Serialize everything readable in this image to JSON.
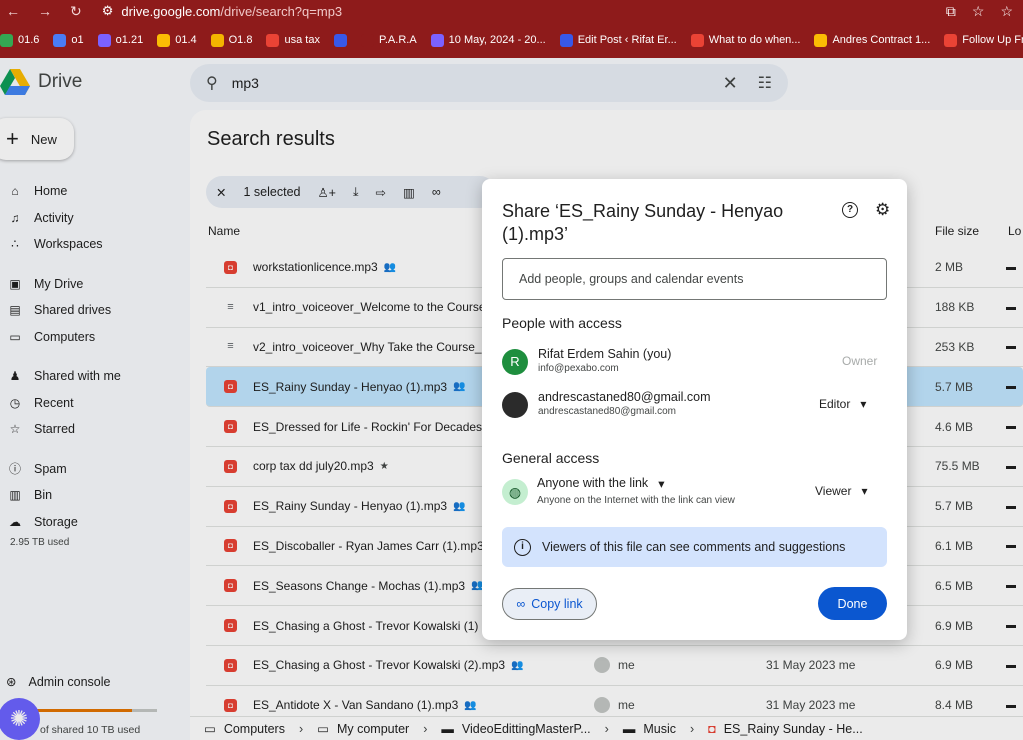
{
  "browser": {
    "url_host": "drive.google.com",
    "url_path": "/drive/search?q=mp3",
    "bookmarks": [
      {
        "label": "01.6",
        "icon": "green-plus-icon",
        "color": "#34a853"
      },
      {
        "label": "o1",
        "icon": "blue-icon",
        "color": "#4a7cf6"
      },
      {
        "label": "o1.21",
        "icon": "purple-icon",
        "color": "#7b61ff"
      },
      {
        "label": "01.4",
        "icon": "drive-icon",
        "color": "#fbbc04"
      },
      {
        "label": "O1.8",
        "icon": "m-icon",
        "color": "#f4b400"
      },
      {
        "label": "usa tax",
        "icon": "gmail-icon",
        "color": "#ea4335"
      },
      {
        "label": "",
        "icon": "wordpress-icon",
        "color": "#3858e9"
      },
      {
        "label": "P.A.R.A",
        "icon": "folder-icon",
        "color": "#8e1b1b"
      },
      {
        "label": "10 May, 2024 - 20...",
        "icon": "gear-icon",
        "color": "#7b61ff"
      },
      {
        "label": "Edit Post ‹ Rifat Er...",
        "icon": "wordpress-icon",
        "color": "#3858e9"
      },
      {
        "label": "What to do when...",
        "icon": "gmail-icon",
        "color": "#ea4335"
      },
      {
        "label": "Andres Contract 1...",
        "icon": "drive-icon",
        "color": "#fbbc04"
      },
      {
        "label": "Follow Up From",
        "icon": "gmail-icon",
        "color": "#ea4335"
      }
    ]
  },
  "app": {
    "logo_text": "Drive",
    "search_query": "mp3",
    "new_label": "New",
    "sidebar": [
      {
        "label": "Home",
        "icon": "home-icon",
        "glyph": "⌂"
      },
      {
        "label": "Activity",
        "icon": "bell-icon",
        "glyph": "♫"
      },
      {
        "label": "Workspaces",
        "icon": "workspaces-icon",
        "glyph": "∴"
      },
      {
        "label": "My Drive",
        "icon": "my-drive-icon",
        "glyph": "▣"
      },
      {
        "label": "Shared drives",
        "icon": "shared-drives-icon",
        "glyph": "▤"
      },
      {
        "label": "Computers",
        "icon": "computers-icon",
        "glyph": "▭"
      },
      {
        "label": "Shared with me",
        "icon": "shared-with-me-icon",
        "glyph": "♟"
      },
      {
        "label": "Recent",
        "icon": "clock-icon",
        "glyph": "◷"
      },
      {
        "label": "Starred",
        "icon": "star-icon",
        "glyph": "☆"
      },
      {
        "label": "Spam",
        "icon": "spam-icon",
        "glyph": "ⓘ"
      },
      {
        "label": "Bin",
        "icon": "bin-icon",
        "glyph": "▥"
      },
      {
        "label": "Storage",
        "icon": "cloud-icon",
        "glyph": "☁"
      }
    ],
    "storage_used": "2.95 TB used",
    "admin_label": "Admin console",
    "shared_used": "of shared 10 TB used",
    "shared_fraction": 0.8
  },
  "main": {
    "title": "Search results",
    "selected_text": "1 selected",
    "columns": {
      "name": "Name",
      "size": "File size",
      "location": "Lo"
    },
    "rows": [
      {
        "name": "workstationlicence.mp3",
        "shared": true,
        "size": "2 MB",
        "type": "audio"
      },
      {
        "name": "v1_intro_voiceover_Welcome to the Course",
        "shared": false,
        "size": "188 KB",
        "type": "doc"
      },
      {
        "name": "v2_intro_voiceover_Why Take the Course_",
        "shared": false,
        "size": "253 KB",
        "type": "doc"
      },
      {
        "name": "ES_Rainy Sunday - Henyao (1).mp3",
        "shared": true,
        "size": "5.7 MB",
        "type": "audio",
        "selected": true
      },
      {
        "name": "ES_Dressed for Life - Rockin' For Decades",
        "shared": false,
        "size": "4.6 MB",
        "type": "audio"
      },
      {
        "name": "corp tax dd july20.mp3",
        "shared": false,
        "starred": true,
        "size": "75.5 MB",
        "type": "audio"
      },
      {
        "name": "ES_Rainy Sunday - Henyao (1).mp3",
        "shared": true,
        "size": "5.7 MB",
        "type": "audio"
      },
      {
        "name": "ES_Discoballer - Ryan James Carr (1).mp3",
        "shared": false,
        "size": "6.1 MB",
        "type": "audio"
      },
      {
        "name": "ES_Seasons Change - Mochas (1).mp3",
        "shared": true,
        "size": "6.5 MB",
        "type": "audio"
      },
      {
        "name": "ES_Chasing a Ghost - Trevor Kowalski (1)",
        "shared": false,
        "size": "6.9 MB",
        "type": "audio"
      },
      {
        "name": "ES_Chasing a Ghost - Trevor Kowalski (2).mp3",
        "shared": true,
        "size": "6.9 MB",
        "type": "audio",
        "owner": "me",
        "modified": "31 May 2023 me"
      },
      {
        "name": "ES_Antidote X - Van Sandano (1).mp3",
        "shared": true,
        "size": "8.4 MB",
        "type": "audio",
        "owner": "me",
        "modified": "31 May 2023 me"
      }
    ],
    "breadcrumb": [
      "Computers",
      "My computer",
      "VideoEdittingMasterP...",
      "Music",
      "ES_Rainy Sunday - He..."
    ]
  },
  "dialog": {
    "title": "Share ‘ES_Rainy Sunday - Henyao (1).mp3’",
    "add_placeholder": "Add people, groups and calendar events",
    "people_heading": "People with access",
    "people": [
      {
        "name": "Rifat Erdem Sahin (you)",
        "email": "info@pexabo.com",
        "role": "Owner",
        "initial": "R"
      },
      {
        "name": "andrescastaned80@gmail.com",
        "email": "andrescastaned80@gmail.com",
        "role": "Editor",
        "initial": ""
      }
    ],
    "general_heading": "General access",
    "access_label": "Anyone with the link",
    "access_sub": "Anyone on the Internet with the link can view",
    "access_role": "Viewer",
    "info_text": "Viewers of this file can see comments and suggestions",
    "copy_link": "Copy link",
    "done": "Done"
  }
}
